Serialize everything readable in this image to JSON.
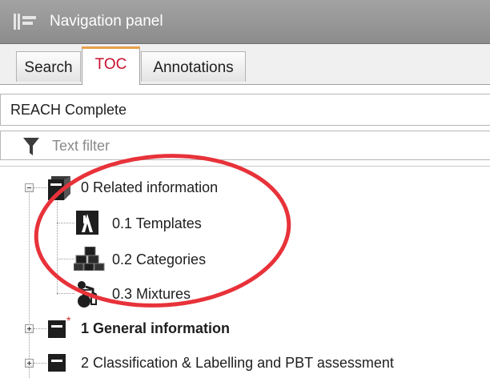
{
  "panel": {
    "title": "Navigation panel",
    "title_icon": "navigation-panel-icon"
  },
  "tabs": [
    {
      "label": "Search",
      "active": false
    },
    {
      "label": "TOC",
      "active": true
    },
    {
      "label": "Annotations",
      "active": false
    }
  ],
  "model_selector": {
    "value": "REACH Complete"
  },
  "filter": {
    "placeholder": "Text filter",
    "icon": "funnel-icon"
  },
  "tree": [
    {
      "label": "0 Related information",
      "expanded": true,
      "bold": false,
      "icon": "section-folder-icon"
    },
    {
      "label": "0.1 Templates",
      "bold": false,
      "icon": "template-icon"
    },
    {
      "label": "0.2 Categories",
      "bold": false,
      "icon": "categories-icon"
    },
    {
      "label": "0.3 Mixtures",
      "bold": false,
      "icon": "mixture-icon"
    },
    {
      "label": "1 General information",
      "expanded": false,
      "bold": true,
      "icon": "section-folder-required-icon"
    },
    {
      "label": "2 Classification & Labelling and PBT assessment",
      "expanded": false,
      "bold": false,
      "icon": "section-folder-icon"
    }
  ],
  "colors": {
    "titlebar": "#8c8c8c",
    "active_tab_text": "#c8102e",
    "active_tab_accent": "#e8a04a",
    "annotation_ring": "#e8323a",
    "required_marker": "#d42b2b"
  }
}
